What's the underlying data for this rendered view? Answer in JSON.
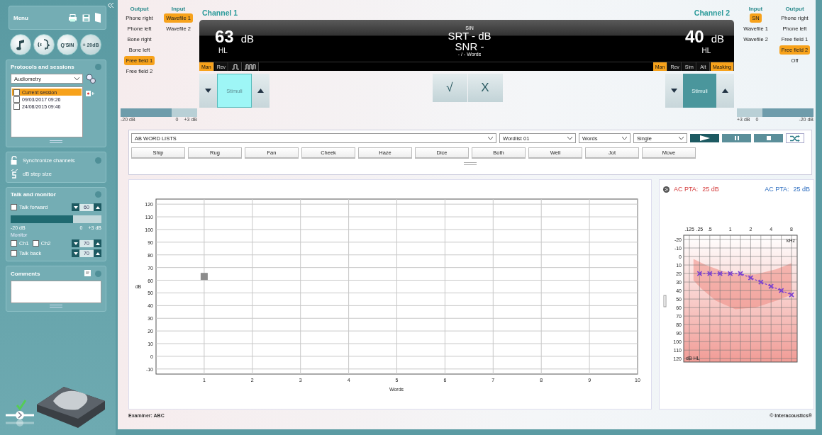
{
  "sidebar": {
    "menu": {
      "title": "Menu"
    },
    "test_buttons": [
      {
        "kind": "note",
        "disabled": false
      },
      {
        "kind": "speech",
        "disabled": false
      },
      {
        "kind": "text",
        "label": "Q'SIN",
        "disabled": false
      },
      {
        "kind": "text",
        "label": "+ 20dB",
        "disabled": true
      }
    ],
    "protocols": {
      "title": "Protocols and sessions",
      "protocol": "Audiometry",
      "sessions": [
        {
          "label": "Current session",
          "selected": true,
          "checked": false
        },
        {
          "label": "09/03/2017 09:26",
          "selected": false,
          "checked": false
        },
        {
          "label": "24/08/2015 09:46",
          "selected": false,
          "checked": false
        }
      ]
    },
    "options": [
      {
        "kind": "lock",
        "label": "Synchronize channels"
      },
      {
        "kind": "step",
        "label": "dB step size"
      }
    ],
    "talk_monitor": {
      "title": "Talk and monitor",
      "talk_forward": {
        "label": "Talk forward",
        "checked": false,
        "value": "60"
      },
      "meter": {
        "level": 0.69,
        "ticks": [
          "-20 dB",
          "0",
          "+3 dB"
        ]
      },
      "monitor_label": "Monitor",
      "monitor_channels": [
        {
          "label": "Ch1",
          "checked": false
        },
        {
          "label": "Ch2",
          "checked": false
        }
      ],
      "monitor_value": "70",
      "talk_back": {
        "label": "Talk back",
        "checked": false,
        "value": "70"
      }
    },
    "comments": {
      "title": "Comments"
    }
  },
  "channel_1": {
    "title": "Channel 1",
    "output_label": "Output",
    "input_label": "Input",
    "outputs": [
      {
        "label": "Phone right",
        "selected": false
      },
      {
        "label": "Phone left",
        "selected": false
      },
      {
        "label": "Bone right",
        "selected": false
      },
      {
        "label": "Bone left",
        "selected": false
      },
      {
        "label": "Free field 1",
        "selected": true
      },
      {
        "label": "Free field 2",
        "selected": false
      }
    ],
    "inputs": [
      {
        "label": "Wavefile 1",
        "selected": true
      },
      {
        "label": "Wavefile 2",
        "selected": false
      }
    ],
    "level": "63",
    "unit": "dB",
    "scale": "HL",
    "modes": [
      {
        "kind": "text",
        "label": "Man",
        "selected": true
      },
      {
        "kind": "text",
        "label": "Rev",
        "selected": false
      },
      {
        "kind": "single-pulse",
        "selected": false
      },
      {
        "kind": "multi-pulse",
        "selected": false
      }
    ],
    "stimuli": {
      "label": "Stimuli",
      "on": true
    },
    "meter": {
      "level": 0.67,
      "ticks": [
        "-20 dB",
        "0",
        "+3 dB"
      ]
    }
  },
  "result": {
    "srt_superscript": "SIN",
    "srt": "SRT - dB",
    "snr": "SNR -",
    "words": "- / - Words",
    "buttons": [
      "√",
      "X"
    ]
  },
  "channel_2": {
    "title": "Channel 2",
    "input_label": "Input",
    "output_label": "Output",
    "inputs": [
      {
        "label": "SN",
        "selected": true
      },
      {
        "label": "Wavefile 1",
        "selected": false
      },
      {
        "label": "Wavefile 2",
        "selected": false
      }
    ],
    "outputs": [
      {
        "label": "Phone right",
        "selected": false
      },
      {
        "label": "Phone left",
        "selected": false
      },
      {
        "label": "Free field 1",
        "selected": false
      },
      {
        "label": "Free field 2",
        "selected": true
      },
      {
        "label": "Off",
        "selected": false
      }
    ],
    "level": "40",
    "unit": "dB",
    "scale": "HL",
    "modes": [
      {
        "kind": "text",
        "label": "Man",
        "selected": true
      },
      {
        "kind": "text",
        "label": "Rev",
        "selected": false
      },
      {
        "kind": "text",
        "label": "Sim",
        "selected": false
      },
      {
        "kind": "text",
        "label": "Alt",
        "selected": false
      },
      {
        "kind": "text",
        "label": "Masking",
        "selected": true
      }
    ],
    "stimuli": {
      "label": "Stimuli",
      "on": false
    },
    "meter": {
      "level": 0.67,
      "ticks": [
        "+3 dB",
        "0",
        "-20 dB"
      ]
    }
  },
  "word_test": {
    "list": "AB WORD LISTS",
    "wordlist": "Wordlist 01",
    "mode": "Words",
    "presentation": "Single",
    "controls": [
      {
        "kind": "play"
      },
      {
        "kind": "pause"
      },
      {
        "kind": "stop"
      },
      {
        "kind": "shuffle"
      }
    ],
    "words": [
      "Ship",
      "Rug",
      "Fan",
      "Cheek",
      "Haze",
      "Dice",
      "Both",
      "Well",
      "Jot",
      "Move"
    ]
  },
  "speech_chart": {
    "chart_data": {
      "type": "scatter",
      "xlabel": "Words",
      "ylabel": "dB",
      "x": [
        1
      ],
      "series": [
        {
          "color": "#8c8c8c",
          "values": [
            63
          ]
        }
      ],
      "xlim": [
        0,
        10
      ],
      "ylim": [
        -14,
        124
      ],
      "grid": true,
      "xticks": [
        1,
        2,
        3,
        4,
        5,
        6,
        7,
        8,
        9,
        10
      ],
      "yticks": [
        -10,
        0,
        10,
        20,
        30,
        40,
        50,
        60,
        70,
        80,
        90,
        100,
        110,
        120
      ]
    }
  },
  "audiogram": {
    "left": {
      "label": "AC PTA:",
      "value": "25 dB"
    },
    "right": {
      "label": "AC PTA:",
      "value": "25 dB"
    },
    "chart_data": {
      "type": "line",
      "xlabel": "kHz",
      "ylabel": "dB HL",
      "categories": [
        ".125",
        ".25",
        ".5",
        null,
        "1",
        null,
        "2",
        null,
        "4",
        null,
        "8"
      ],
      "series": [
        {
          "color": "#7a3fd0",
          "line_style": "dashed",
          "marker": "cross",
          "values": [
            null,
            20,
            20,
            20,
            20,
            20,
            25,
            30,
            35,
            40,
            45
          ]
        }
      ],
      "ylim": [
        124,
        -25
      ],
      "grid": true,
      "yticks": [
        -20,
        -10,
        0,
        10,
        20,
        30,
        40,
        50,
        60,
        70,
        80,
        90,
        100,
        110,
        120
      ]
    }
  },
  "status_bar": {
    "examiner": "Examiner: ABC",
    "copyright": "© Interacoustics®"
  }
}
